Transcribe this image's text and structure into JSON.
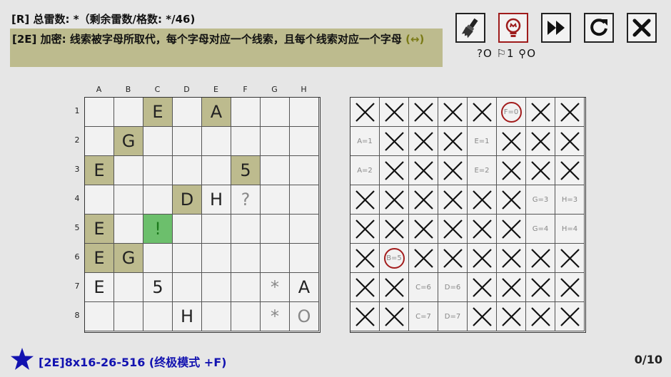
{
  "header": {
    "mine_line": "[R] 总雷数: *（剩余雷数/格数: */46)",
    "rule_text": "[2E] 加密: 线索被字母所取代，每个字母对应一个线索，且每个线索对应一个字母",
    "rule_arrow": "(↔)"
  },
  "toolbar": {
    "buttons": [
      {
        "name": "brush-button",
        "icon": "paint-brush-icon"
      },
      {
        "name": "hint-button",
        "icon": "lightbulb-icon"
      },
      {
        "name": "fast-forward-button",
        "icon": "fast-forward-icon"
      },
      {
        "name": "restart-button",
        "icon": "restart-icon"
      },
      {
        "name": "close-button",
        "icon": "close-icon"
      }
    ],
    "status": "?O ⚐1 ⚲O"
  },
  "board": {
    "columns": [
      "A",
      "B",
      "C",
      "D",
      "E",
      "F",
      "G",
      "H"
    ],
    "rows": [
      "1",
      "2",
      "3",
      "4",
      "5",
      "6",
      "7",
      "8"
    ],
    "cells": [
      [
        {
          "t": ""
        },
        {
          "t": ""
        },
        {
          "t": "E",
          "s": "olive"
        },
        {
          "t": ""
        },
        {
          "t": "A",
          "s": "olive"
        },
        {
          "t": ""
        },
        {
          "t": ""
        },
        {
          "t": ""
        }
      ],
      [
        {
          "t": ""
        },
        {
          "t": "G",
          "s": "olive"
        },
        {
          "t": ""
        },
        {
          "t": ""
        },
        {
          "t": ""
        },
        {
          "t": ""
        },
        {
          "t": ""
        },
        {
          "t": ""
        }
      ],
      [
        {
          "t": "E",
          "s": "olive"
        },
        {
          "t": ""
        },
        {
          "t": ""
        },
        {
          "t": ""
        },
        {
          "t": ""
        },
        {
          "t": "5",
          "s": "olive"
        },
        {
          "t": ""
        },
        {
          "t": ""
        }
      ],
      [
        {
          "t": ""
        },
        {
          "t": ""
        },
        {
          "t": ""
        },
        {
          "t": "D",
          "s": "olive"
        },
        {
          "t": "H"
        },
        {
          "t": "?",
          "s": "gray"
        },
        {
          "t": ""
        },
        {
          "t": ""
        }
      ],
      [
        {
          "t": "E",
          "s": "olive"
        },
        {
          "t": ""
        },
        {
          "t": "!",
          "s": "green"
        },
        {
          "t": ""
        },
        {
          "t": ""
        },
        {
          "t": ""
        },
        {
          "t": ""
        },
        {
          "t": ""
        }
      ],
      [
        {
          "t": "E",
          "s": "olive"
        },
        {
          "t": "G",
          "s": "olive"
        },
        {
          "t": ""
        },
        {
          "t": ""
        },
        {
          "t": ""
        },
        {
          "t": ""
        },
        {
          "t": ""
        },
        {
          "t": ""
        }
      ],
      [
        {
          "t": "E"
        },
        {
          "t": ""
        },
        {
          "t": "5"
        },
        {
          "t": ""
        },
        {
          "t": ""
        },
        {
          "t": ""
        },
        {
          "t": "*",
          "s": "gray"
        },
        {
          "t": "A"
        }
      ],
      [
        {
          "t": ""
        },
        {
          "t": ""
        },
        {
          "t": ""
        },
        {
          "t": "H"
        },
        {
          "t": ""
        },
        {
          "t": ""
        },
        {
          "t": "*",
          "s": "gray"
        },
        {
          "t": "O",
          "s": "gray"
        }
      ]
    ]
  },
  "cipher_table": {
    "cells": [
      [
        "x",
        "x",
        "x",
        "x",
        "x",
        "(F=0)",
        "x",
        "x"
      ],
      [
        "A=1",
        "x",
        "x",
        "x",
        "E=1",
        "x",
        "x",
        "x"
      ],
      [
        "A=2",
        "x",
        "x",
        "x",
        "E=2",
        "x",
        "x",
        "x"
      ],
      [
        "x",
        "x",
        "x",
        "x",
        "x",
        "x",
        "G=3",
        "H=3"
      ],
      [
        "x",
        "x",
        "x",
        "x",
        "x",
        "x",
        "G=4",
        "H=4"
      ],
      [
        "x",
        "(B=5)",
        "x",
        "x",
        "x",
        "x",
        "x",
        "x"
      ],
      [
        "x",
        "x",
        "C=6",
        "D=6",
        "x",
        "x",
        "x",
        "x"
      ],
      [
        "x",
        "x",
        "C=7",
        "D=7",
        "x",
        "x",
        "x",
        "x"
      ]
    ]
  },
  "footer": {
    "icon": "star-icon",
    "title": "[2E]8x16-26-516 (终极模式 +F)",
    "progress": "0/10"
  },
  "colors": {
    "olive": "#bdbb8e",
    "green": "#6cbf6c",
    "ring": "#a31d1d",
    "title_blue": "#1212b0"
  }
}
